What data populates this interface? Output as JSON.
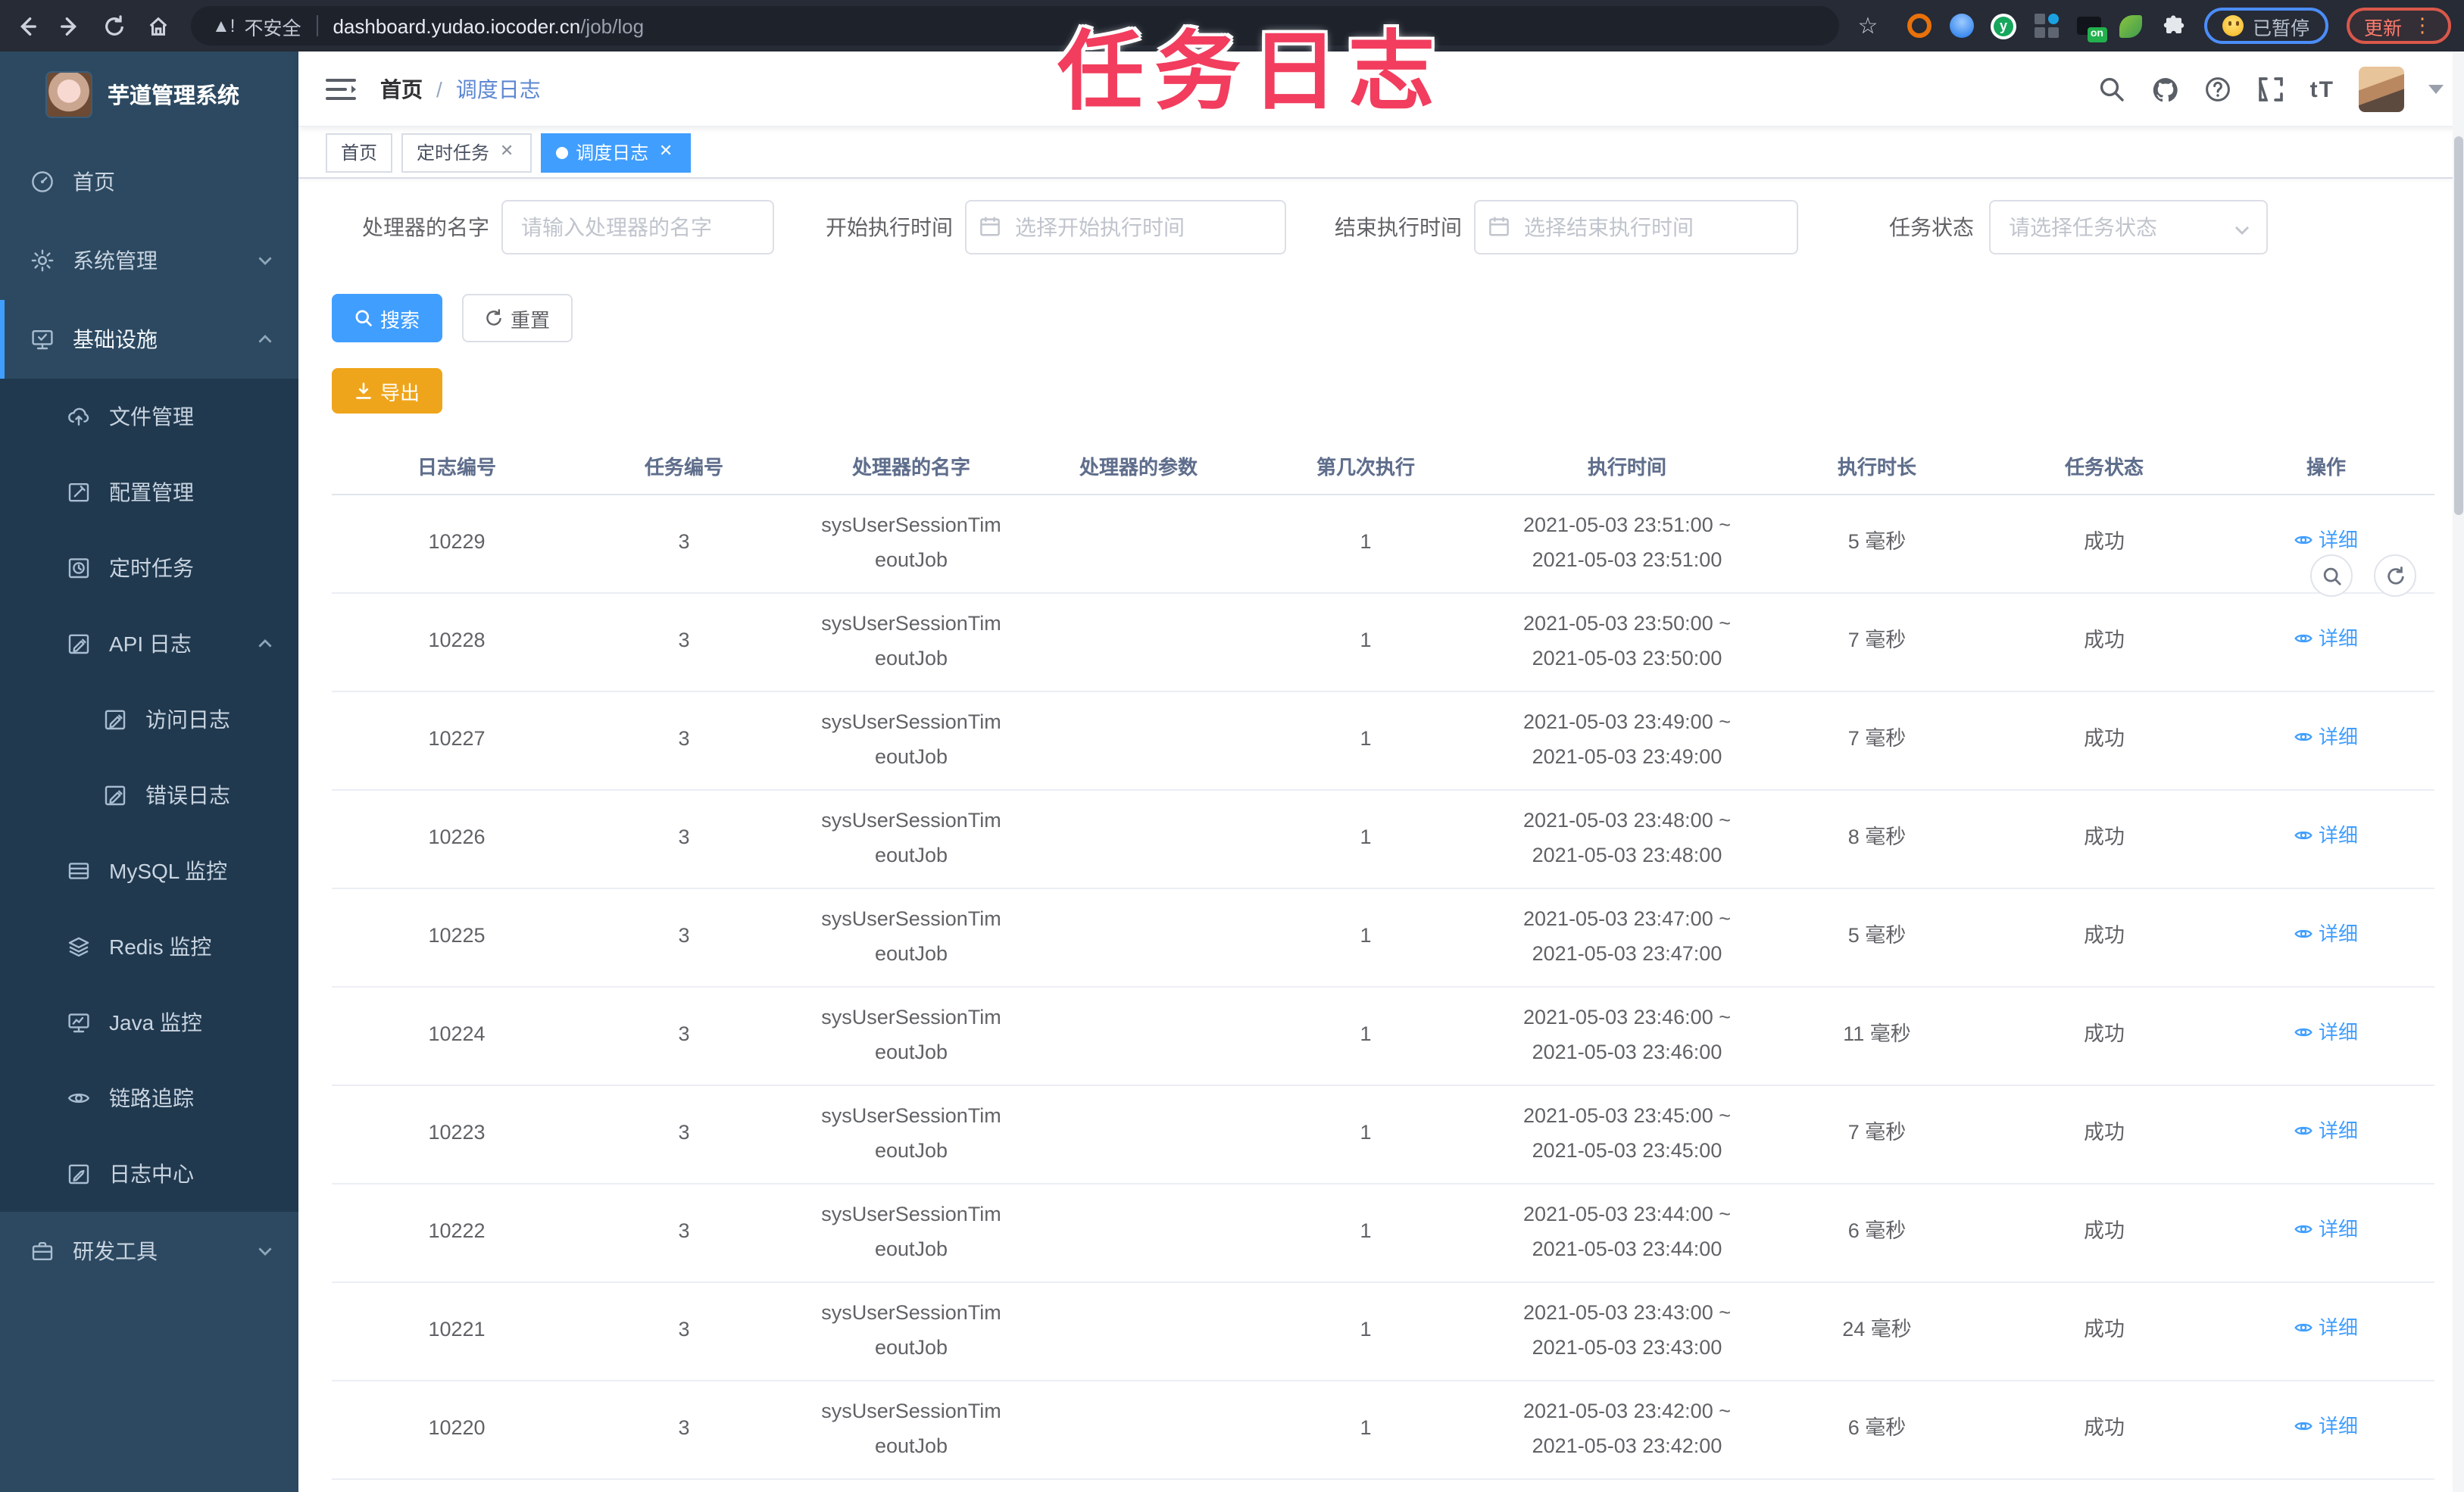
{
  "annotation": {
    "text": "任务日志",
    "color": "#f23d5e"
  },
  "browser": {
    "insecure_label": "不安全",
    "url_host": "dashboard.yudao.iocoder.cn",
    "url_path": "/job/log",
    "paused_pill_label": "已暂停",
    "update_pill_label": "更新",
    "extension_icons": [
      "orange-ring-extension-icon",
      "blue-bulb-extension-icon",
      "green-y-extension-icon",
      "grid-extension-icon",
      "on-badge-extension-icon",
      "green-leaf-extension-icon",
      "puzzle-extensions-icon"
    ]
  },
  "sidebar": {
    "title": "芋道管理系统",
    "logo_icon": "rabbit-avatar",
    "items": [
      {
        "key": "home",
        "label": "首页",
        "icon": "dashboard-icon",
        "level": 0
      },
      {
        "key": "system-management",
        "label": "系统管理",
        "icon": "gear-icon",
        "level": 0,
        "chevron": "down"
      },
      {
        "key": "infrastructure",
        "label": "基础设施",
        "icon": "monitor-check-icon",
        "level": 0,
        "chevron": "up",
        "active": true
      },
      {
        "key": "file-management",
        "label": "文件管理",
        "icon": "cloud-upload-icon",
        "level": 1
      },
      {
        "key": "config-management",
        "label": "配置管理",
        "icon": "edit-square-icon",
        "level": 1
      },
      {
        "key": "scheduled-tasks",
        "label": "定时任务",
        "icon": "clock-icon",
        "level": 1
      },
      {
        "key": "api-log",
        "label": "API 日志",
        "icon": "log-edit-icon",
        "level": 1,
        "chevron": "up"
      },
      {
        "key": "access-log",
        "label": "访问日志",
        "icon": "log-edit-icon",
        "level": 2
      },
      {
        "key": "error-log",
        "label": "错误日志",
        "icon": "log-edit-icon",
        "level": 2
      },
      {
        "key": "mysql-monitor",
        "label": "MySQL 监控",
        "icon": "rows-icon",
        "level": 1
      },
      {
        "key": "redis-monitor",
        "label": "Redis 监控",
        "icon": "layers-icon",
        "level": 1
      },
      {
        "key": "java-monitor",
        "label": "Java 监控",
        "icon": "monitor-icon",
        "level": 1
      },
      {
        "key": "trace",
        "label": "链路追踪",
        "icon": "eye-icon",
        "level": 1
      },
      {
        "key": "log-center",
        "label": "日志中心",
        "icon": "pen-square-icon",
        "level": 1
      },
      {
        "key": "dev-tools",
        "label": "研发工具",
        "icon": "briefcase-icon",
        "level": 0,
        "chevron": "down"
      }
    ]
  },
  "navbar": {
    "breadcrumb_home": "首页",
    "breadcrumb_separator": "/",
    "breadcrumb_current": "调度日志",
    "icons": [
      "search-icon",
      "github-icon",
      "help-icon",
      "fullscreen-icon",
      "font-size-icon",
      "avatar",
      "caret-down-icon"
    ]
  },
  "tags": [
    {
      "label": "首页",
      "closable": false,
      "active": false
    },
    {
      "label": "定时任务",
      "closable": true,
      "active": false
    },
    {
      "label": "调度日志",
      "closable": true,
      "active": true
    }
  ],
  "filters": {
    "handler_label": "处理器的名字",
    "handler_placeholder": "请输入处理器的名字",
    "start_label": "开始执行时间",
    "start_placeholder": "选择开始执行时间",
    "end_label": "结束执行时间",
    "end_placeholder": "选择结束执行时间",
    "status_label": "任务状态",
    "status_placeholder": "请选择任务状态",
    "search_button": "搜索",
    "reset_button": "重置",
    "export_button": "导出"
  },
  "table": {
    "columns": [
      "日志编号",
      "任务编号",
      "处理器的名字",
      "处理器的参数",
      "第几次执行",
      "执行时间",
      "执行时长",
      "任务状态",
      "操作"
    ],
    "detail_label": "详细",
    "rows": [
      {
        "log_id": "10229",
        "task_id": "3",
        "handler_line1": "sysUserSessionTim",
        "handler_line2": "eoutJob",
        "param": "",
        "execute_index": "1",
        "time_line1": "2021-05-03 23:51:00 ~",
        "time_line2": "2021-05-03 23:51:00",
        "duration": "5 毫秒",
        "status": "成功"
      },
      {
        "log_id": "10228",
        "task_id": "3",
        "handler_line1": "sysUserSessionTim",
        "handler_line2": "eoutJob",
        "param": "",
        "execute_index": "1",
        "time_line1": "2021-05-03 23:50:00 ~",
        "time_line2": "2021-05-03 23:50:00",
        "duration": "7 毫秒",
        "status": "成功"
      },
      {
        "log_id": "10227",
        "task_id": "3",
        "handler_line1": "sysUserSessionTim",
        "handler_line2": "eoutJob",
        "param": "",
        "execute_index": "1",
        "time_line1": "2021-05-03 23:49:00 ~",
        "time_line2": "2021-05-03 23:49:00",
        "duration": "7 毫秒",
        "status": "成功"
      },
      {
        "log_id": "10226",
        "task_id": "3",
        "handler_line1": "sysUserSessionTim",
        "handler_line2": "eoutJob",
        "param": "",
        "execute_index": "1",
        "time_line1": "2021-05-03 23:48:00 ~",
        "time_line2": "2021-05-03 23:48:00",
        "duration": "8 毫秒",
        "status": "成功"
      },
      {
        "log_id": "10225",
        "task_id": "3",
        "handler_line1": "sysUserSessionTim",
        "handler_line2": "eoutJob",
        "param": "",
        "execute_index": "1",
        "time_line1": "2021-05-03 23:47:00 ~",
        "time_line2": "2021-05-03 23:47:00",
        "duration": "5 毫秒",
        "status": "成功"
      },
      {
        "log_id": "10224",
        "task_id": "3",
        "handler_line1": "sysUserSessionTim",
        "handler_line2": "eoutJob",
        "param": "",
        "execute_index": "1",
        "time_line1": "2021-05-03 23:46:00 ~",
        "time_line2": "2021-05-03 23:46:00",
        "duration": "11 毫秒",
        "status": "成功"
      },
      {
        "log_id": "10223",
        "task_id": "3",
        "handler_line1": "sysUserSessionTim",
        "handler_line2": "eoutJob",
        "param": "",
        "execute_index": "1",
        "time_line1": "2021-05-03 23:45:00 ~",
        "time_line2": "2021-05-03 23:45:00",
        "duration": "7 毫秒",
        "status": "成功"
      },
      {
        "log_id": "10222",
        "task_id": "3",
        "handler_line1": "sysUserSessionTim",
        "handler_line2": "eoutJob",
        "param": "",
        "execute_index": "1",
        "time_line1": "2021-05-03 23:44:00 ~",
        "time_line2": "2021-05-03 23:44:00",
        "duration": "6 毫秒",
        "status": "成功"
      },
      {
        "log_id": "10221",
        "task_id": "3",
        "handler_line1": "sysUserSessionTim",
        "handler_line2": "eoutJob",
        "param": "",
        "execute_index": "1",
        "time_line1": "2021-05-03 23:43:00 ~",
        "time_line2": "2021-05-03 23:43:00",
        "duration": "24 毫秒",
        "status": "成功"
      },
      {
        "log_id": "10220",
        "task_id": "3",
        "handler_line1": "sysUserSessionTim",
        "handler_line2": "eoutJob",
        "param": "",
        "execute_index": "1",
        "time_line1": "2021-05-03 23:42:00 ~",
        "time_line2": "2021-05-03 23:42:00",
        "duration": "6 毫秒",
        "status": "成功"
      }
    ]
  }
}
